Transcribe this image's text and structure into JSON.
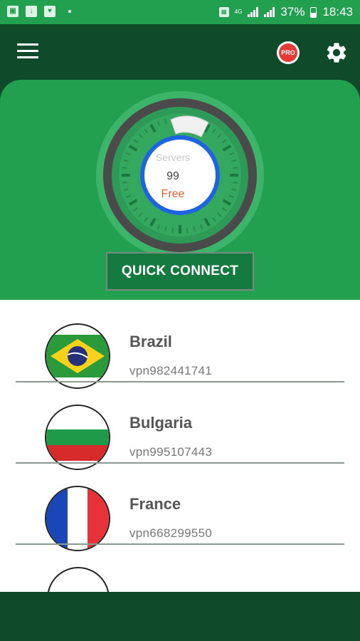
{
  "status_bar": {
    "battery": "37%",
    "time": "18:43",
    "network": "4G"
  },
  "app_bar": {
    "pro_label": "PRO"
  },
  "gauge": {
    "servers_label": "Servers",
    "servers_count": "99",
    "tier": "Free"
  },
  "quick_connect_label": "QUICK CONNECT",
  "servers": [
    {
      "country": "Brazil",
      "host": "vpn982441741",
      "flag": "brazil-flag-icon"
    },
    {
      "country": "Bulgaria",
      "host": "vpn995107443",
      "flag": "bulgaria-flag-icon"
    },
    {
      "country": "France",
      "host": "vpn668299550",
      "flag": "france-flag-icon"
    }
  ],
  "colors": {
    "primary": "#22a050",
    "dark": "#0f4a2a",
    "button": "#157a40",
    "free_text": "#e0602a"
  }
}
